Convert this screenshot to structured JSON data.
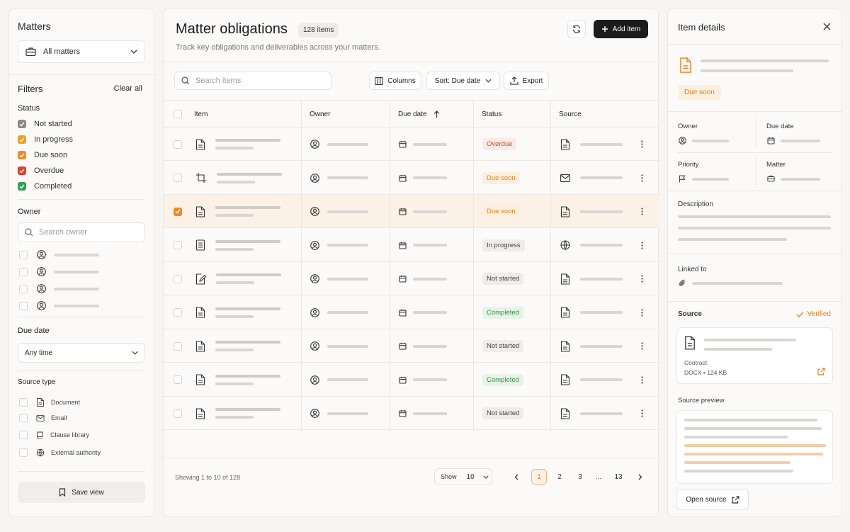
{
  "left": {
    "title": "Matters",
    "matters_select": "All matters",
    "filters_label": "Filters",
    "clear_all": "Clear all",
    "status_label": "Status",
    "statuses": [
      {
        "label": "Not started",
        "color": "#8c8884"
      },
      {
        "label": "In progress",
        "color": "#f0a020"
      },
      {
        "label": "Due soon",
        "color": "#f08a28"
      },
      {
        "label": "Overdue",
        "color": "#e0402e"
      },
      {
        "label": "Completed",
        "color": "#32a350"
      }
    ],
    "owner_label": "Owner",
    "owner_search_placeholder": "Search owner",
    "due_date_label": "Due date",
    "due_date_value": "Any time",
    "source_type_label": "Source type",
    "source_types": [
      {
        "label": "Document",
        "icon": "document-icon"
      },
      {
        "label": "Email",
        "icon": "email-icon"
      },
      {
        "label": "Clause library",
        "icon": "clause-library-icon"
      },
      {
        "label": "External authority",
        "icon": "globe-icon"
      }
    ],
    "save_view": "Save view"
  },
  "center": {
    "title": "Matter obligations",
    "count_badge": "128 items",
    "subtitle": "Track key obligations and deliverables across your matters.",
    "add_item": "Add item",
    "search_placeholder": "Search items",
    "columns_btn": "Columns",
    "sort_btn": "Sort: Due date",
    "export_btn": "Export",
    "headers": [
      "Item",
      "Owner",
      "Due date",
      "Status",
      "Source"
    ],
    "rows": [
      {
        "item_icon": "document-icon",
        "status": "Overdue",
        "status_kind": "overdue",
        "source_icon": "document-icon",
        "selected": false
      },
      {
        "item_icon": "crop-icon",
        "status": "Due soon",
        "status_kind": "duesoon",
        "source_icon": "email-icon",
        "selected": false
      },
      {
        "item_icon": "document-icon",
        "status": "Due soon",
        "status_kind": "duesoon",
        "source_icon": "document-icon",
        "selected": true
      },
      {
        "item_icon": "list-document-icon",
        "status": "In progress",
        "status_kind": "progress",
        "source_icon": "globe-icon",
        "selected": false
      },
      {
        "item_icon": "edit-document-icon",
        "status": "Not started",
        "status_kind": "notstarted",
        "source_icon": "document-icon",
        "selected": false
      },
      {
        "item_icon": "document-icon",
        "status": "Completed",
        "status_kind": "completed",
        "source_icon": "document-icon",
        "selected": false
      },
      {
        "item_icon": "document-icon",
        "status": "Not started",
        "status_kind": "notstarted",
        "source_icon": "document-icon",
        "selected": false
      },
      {
        "item_icon": "document-icon",
        "status": "Completed",
        "status_kind": "completed",
        "source_icon": "document-icon",
        "selected": false
      },
      {
        "item_icon": "document-icon",
        "status": "Not started",
        "status_kind": "notstarted",
        "source_icon": "document-icon",
        "selected": false
      }
    ],
    "footer_showing": "Showing 1 to 10 of 128",
    "show_label": "Show",
    "show_value": "10",
    "pages": [
      "1",
      "2",
      "3",
      "...",
      "13"
    ],
    "active_page": "1"
  },
  "right": {
    "title": "Item details",
    "due_pill": "Due soon",
    "owner_label": "Owner",
    "due_date_label": "Due date",
    "priority_label": "Priority",
    "matter_label": "Matter",
    "description_label": "Description",
    "linked_to_label": "Linked to",
    "source_label": "Source",
    "verified": "Verified",
    "source_file_type": "Contract",
    "source_file_meta": "DOCX • 124 KB",
    "source_preview_label": "Source preview",
    "open_source": "Open source"
  },
  "colors": {
    "accent": "#e8811f",
    "primary_button": "#1c1c1c"
  }
}
